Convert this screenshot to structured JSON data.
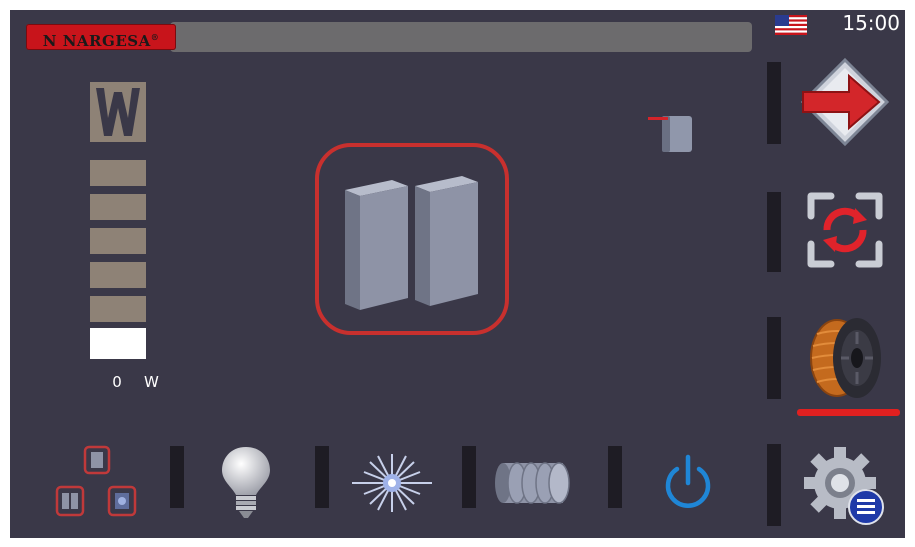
{
  "top_bar": {
    "brand": "N NARGESA",
    "registered_mark": "®",
    "title": "",
    "language_flag": "us-flag-icon",
    "clock": "15:00"
  },
  "power_meter": {
    "letter_icon": "w-letter-icon",
    "value": "0",
    "unit": "W",
    "level_fraction": 0.0,
    "segments_total": 6
  },
  "mode_display": {
    "icon": "two-blocks-icon",
    "selected": true
  },
  "right_menu": [
    {
      "name": "exit",
      "icon": "red-arrow-exit-icon"
    },
    {
      "name": "refresh",
      "icon": "rotate-frame-icon"
    },
    {
      "name": "wire-spool",
      "icon": "copper-spool-icon",
      "active": true
    },
    {
      "name": "settings",
      "icon": "gear-list-icon"
    }
  ],
  "bottom_menu": [
    {
      "name": "modes",
      "icon": "three-modes-icon"
    },
    {
      "name": "light",
      "icon": "light-bulb-icon"
    },
    {
      "name": "laser",
      "icon": "laser-burst-icon"
    },
    {
      "name": "stack",
      "icon": "stacked-discs-icon"
    },
    {
      "name": "power",
      "icon": "power-icon"
    }
  ],
  "colors": {
    "background": "#3a3848",
    "accent_red": "#c8302e",
    "meter_segment": "#8e8276",
    "power_blue": "#1f86d6"
  }
}
